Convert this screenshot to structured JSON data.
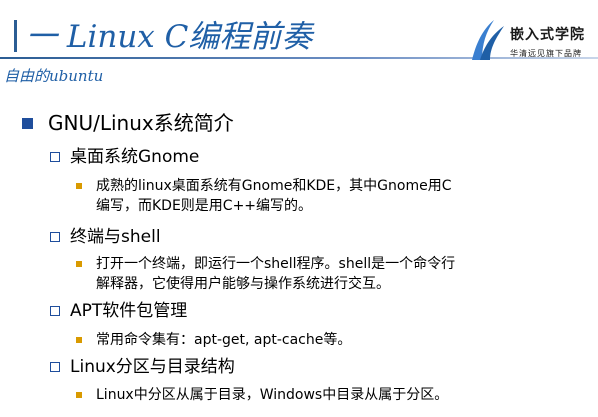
{
  "header": {
    "title": "一 Linux C编程前奏",
    "subtitle": "自由的ubuntu"
  },
  "logo": {
    "name": "嵌入式学院",
    "tagline": "华清远见旗下品牌"
  },
  "section": {
    "title": "GNU/Linux系统简介"
  },
  "items": [
    {
      "title": "桌面系统Gnome",
      "detail_lines": [
        "成熟的linux桌面系统有Gnome和KDE，其中Gnome用C",
        "编写，而KDE则是用C++编写的。"
      ]
    },
    {
      "title": "终端与shell",
      "detail_lines": [
        "打开一个终端，即运行一个shell程序。shell是一个命令行",
        "解释器，它使得用户能够与操作系统进行交互。"
      ]
    },
    {
      "title": "APT软件包管理",
      "detail_lines": [
        "常用命令集有：apt-get, apt-cache等。"
      ]
    },
    {
      "title": "Linux分区与目录结构",
      "detail_lines": [
        "Linux中分区从属于目录，Windows中目录从属于分区。"
      ]
    }
  ],
  "colors": {
    "title": "#1f5fa6",
    "level1_bullet": "#1f4e9c",
    "level2_bullet_border": "#1f4e9c",
    "level3_bullet": "#d99a00"
  }
}
